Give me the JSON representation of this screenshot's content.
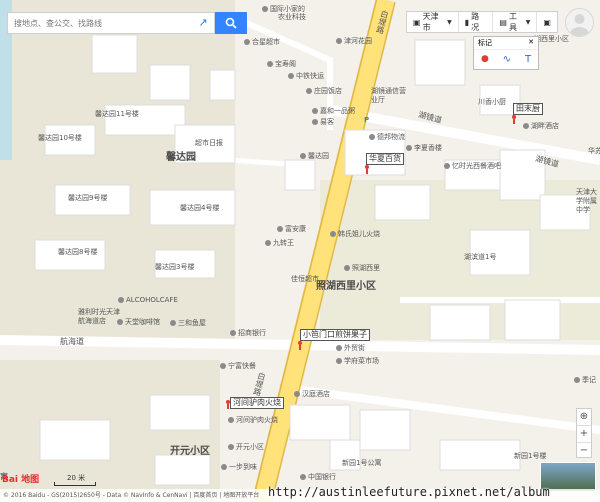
{
  "search": {
    "placeholder": "搜地点、查公交、找路线"
  },
  "toolbar": {
    "city": "天津市",
    "traffic": "路况",
    "tools": "工具"
  },
  "mark_panel": {
    "title": "标记",
    "text_tool": "T"
  },
  "districts": {
    "xinda": "馨达园",
    "zhaohu": "照湖西里小区",
    "kaiyuan": "开元小区"
  },
  "roads": {
    "hangda": "航海道",
    "hujing": "湖镜道",
    "zhaohu_road": "湖镜道",
    "baidi_v1": "白堤路",
    "baidi_v2": "白堤路"
  },
  "buildings": {
    "b11": "馨达园11号楼",
    "b10": "馨达园10号楼",
    "b9": "馨达园9号楼",
    "b4": "馨达园4号楼",
    "b8": "馨达园8号楼",
    "b3": "馨达园3号楼",
    "b1": "新园1号楼",
    "bcheng": "新园1号公寓"
  },
  "pois": {
    "p1": "国际小家的",
    "p1b": "农业科技",
    "p2": "津河花园",
    "p3": "合星超市",
    "p4": "宝寿阁",
    "p5": "中铁快运",
    "p6": "庄园饭店",
    "p7": "嘉和一品粥",
    "p8": "易客",
    "p9": "湖镜通信营业厅",
    "p10": "德邦物流",
    "p11": "李夏香楼",
    "p12": "忆时光西餐酒吧",
    "p13": "超市日报",
    "p14": "馨达园",
    "p15": "富安康",
    "p16": "九转王",
    "p17": "韩氏姐儿火烧",
    "p18": "照湖西里",
    "p19": "ALCOHOLCAFE",
    "p20": "雅利时光天津航海道店",
    "p21": "天堂咖啡馆",
    "p22": "三和鱼屋",
    "p23": "招商银行",
    "p24": "宁富快餐",
    "p25": "外贸街",
    "p26": "学府菜市场",
    "p27": "汉庭酒店",
    "p28": "河间驴肉火烧",
    "p29": "开元小区",
    "p30": "一步到味",
    "p31": "中国银行",
    "p32": "湖滨道1号",
    "p33": "佳恒超市",
    "p34": "华苏",
    "p35": "天津大学附属中学",
    "p36": "川香小厨",
    "p37": "湖畔酒店",
    "p38": "季记",
    "p39": "湖滨道",
    "p40": "湖西里小区"
  },
  "tags": {
    "t1": "华夏百货",
    "t2": "小笆门口煎饼果子",
    "t3": "河间驴肉火烧",
    "t4": "田末厨"
  },
  "scale": "20 米",
  "logo": "Bai 地图",
  "edge_label": "寓",
  "copyright": "© 2016 Baidu - GS(2015)2650号 - Data © NavInfo & CenNavi | 百度首页 | 地图开放平台",
  "watermark": "http://austinleefuture.pixnet.net/album",
  "colors": {
    "road_major": "#ffe27a",
    "road_edge": "#e1b94a",
    "building": "#ffffff",
    "block": "#ebe8dc",
    "accent": "#3385ff"
  }
}
